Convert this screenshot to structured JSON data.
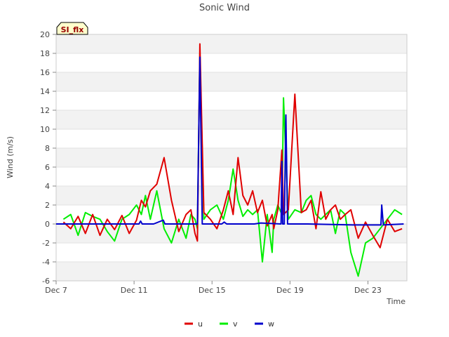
{
  "chart_data": {
    "type": "line",
    "title": "Sonic Wind",
    "xlabel": "Time",
    "ylabel": "Wind (m/s)",
    "badge": "SI_flx",
    "ylim": [
      -6,
      20
    ],
    "yticks": [
      -6,
      -4,
      -2,
      0,
      2,
      4,
      6,
      8,
      10,
      12,
      14,
      16,
      18,
      20
    ],
    "xlim": [
      "2023-12-07",
      "2023-12-25"
    ],
    "xticks": [
      {
        "date": "2023-12-07",
        "label": "Dec 7"
      },
      {
        "date": "2023-12-11",
        "label": "Dec 11"
      },
      {
        "date": "2023-12-15",
        "label": "Dec 15"
      },
      {
        "date": "2023-12-19",
        "label": "Dec 19"
      },
      {
        "date": "2023-12-23",
        "label": "Dec 23"
      }
    ],
    "grid": "horizontal bands",
    "legend": "bottom-center",
    "series": [
      {
        "name": "u",
        "color": "#e00000",
        "x": [
          "2023-12-07T09:00",
          "2023-12-07T18:00",
          "2023-12-08T03:00",
          "2023-12-08T12:00",
          "2023-12-08T21:00",
          "2023-12-09T06:00",
          "2023-12-09T15:00",
          "2023-12-10T00:00",
          "2023-12-10T09:00",
          "2023-12-10T18:00",
          "2023-12-11T03:00",
          "2023-12-11T09:00",
          "2023-12-11T14:00",
          "2023-12-11T20:00",
          "2023-12-12T04:00",
          "2023-12-12T13:00",
          "2023-12-12T22:00",
          "2023-12-13T07:00",
          "2023-12-13T16:00",
          "2023-12-13T22:00",
          "2023-12-14T03:00",
          "2023-12-14T06:00",
          "2023-12-14T09:00",
          "2023-12-14T14:00",
          "2023-12-14T22:00",
          "2023-12-15T06:00",
          "2023-12-15T14:00",
          "2023-12-15T20:00",
          "2023-12-16T02:00",
          "2023-12-16T08:00",
          "2023-12-16T14:00",
          "2023-12-16T20:00",
          "2023-12-17T02:00",
          "2023-12-17T08:00",
          "2023-12-17T14:00",
          "2023-12-17T20:00",
          "2023-12-18T02:00",
          "2023-12-18T04:00",
          "2023-12-18T09:00",
          "2023-12-18T14:00",
          "2023-12-18T16:00",
          "2023-12-18T22:00",
          "2023-12-19T06:00",
          "2023-12-19T14:00",
          "2023-12-19T20:00",
          "2023-12-20T02:00",
          "2023-12-20T08:00",
          "2023-12-20T14:00",
          "2023-12-20T20:00",
          "2023-12-21T02:00",
          "2023-12-21T08:00",
          "2023-12-21T14:00",
          "2023-12-21T20:00",
          "2023-12-22T03:00",
          "2023-12-22T12:00",
          "2023-12-22T21:00",
          "2023-12-23T06:00",
          "2023-12-23T15:00",
          "2023-12-24T00:00",
          "2023-12-24T09:00",
          "2023-12-24T18:00"
        ],
        "values": [
          0.2,
          -0.5,
          0.8,
          -1.0,
          1.0,
          -1.2,
          0.5,
          -0.6,
          0.9,
          -1.0,
          0.4,
          2.5,
          1.8,
          3.5,
          4.2,
          7.0,
          2.5,
          -0.8,
          1.0,
          1.5,
          -1.0,
          -1.8,
          19.0,
          1.2,
          0.5,
          -0.5,
          1.5,
          3.5,
          1.0,
          7.0,
          3.0,
          2.0,
          3.5,
          1.2,
          2.5,
          -0.2,
          1.0,
          -0.5,
          1.5,
          7.8,
          1.0,
          1.5,
          13.7,
          1.2,
          1.5,
          2.5,
          -0.5,
          3.4,
          0.5,
          1.5,
          2.0,
          0.5,
          1.0,
          1.5,
          -1.5,
          0.2,
          -1.2,
          -2.5,
          0.5,
          -0.8,
          -0.5
        ]
      },
      {
        "name": "v",
        "color": "#00ee00",
        "x": [
          "2023-12-07T09:00",
          "2023-12-07T18:00",
          "2023-12-08T03:00",
          "2023-12-08T12:00",
          "2023-12-08T21:00",
          "2023-12-09T06:00",
          "2023-12-09T15:00",
          "2023-12-10T00:00",
          "2023-12-10T09:00",
          "2023-12-10T18:00",
          "2023-12-11T03:00",
          "2023-12-11T09:00",
          "2023-12-11T14:00",
          "2023-12-11T20:00",
          "2023-12-12T04:00",
          "2023-12-12T13:00",
          "2023-12-12T22:00",
          "2023-12-13T07:00",
          "2023-12-13T16:00",
          "2023-12-13T22:00",
          "2023-12-14T03:00",
          "2023-12-14T06:00",
          "2023-12-14T09:00",
          "2023-12-14T14:00",
          "2023-12-14T22:00",
          "2023-12-15T06:00",
          "2023-12-15T14:00",
          "2023-12-15T20:00",
          "2023-12-16T02:00",
          "2023-12-16T08:00",
          "2023-12-16T14:00",
          "2023-12-16T20:00",
          "2023-12-17T02:00",
          "2023-12-17T08:00",
          "2023-12-17T14:00",
          "2023-12-17T20:00",
          "2023-12-18T02:00",
          "2023-12-18T04:00",
          "2023-12-18T09:00",
          "2023-12-18T14:00",
          "2023-12-18T16:00",
          "2023-12-18T22:00",
          "2023-12-19T06:00",
          "2023-12-19T14:00",
          "2023-12-19T20:00",
          "2023-12-20T02:00",
          "2023-12-20T08:00",
          "2023-12-20T14:00",
          "2023-12-20T20:00",
          "2023-12-21T02:00",
          "2023-12-21T08:00",
          "2023-12-21T14:00",
          "2023-12-21T20:00",
          "2023-12-22T03:00",
          "2023-12-22T12:00",
          "2023-12-22T21:00",
          "2023-12-23T06:00",
          "2023-12-23T15:00",
          "2023-12-24T00:00",
          "2023-12-24T09:00",
          "2023-12-24T18:00"
        ],
        "values": [
          0.5,
          1.0,
          -1.2,
          1.2,
          0.8,
          0.5,
          -0.8,
          -1.8,
          0.5,
          1.0,
          2.0,
          1.0,
          3.0,
          0.5,
          3.5,
          -0.5,
          -2.0,
          0.5,
          -1.5,
          1.0,
          0.5,
          -0.5,
          18.0,
          0.5,
          1.5,
          2.0,
          0.5,
          2.5,
          5.8,
          2.5,
          0.8,
          1.5,
          1.0,
          1.5,
          -4.0,
          1.0,
          -3.0,
          0.5,
          2.0,
          1.0,
          13.3,
          0.5,
          1.5,
          1.2,
          2.5,
          3.0,
          1.0,
          0.5,
          1.0,
          1.5,
          -1.0,
          1.5,
          1.0,
          -3.0,
          -5.5,
          -2.0,
          -1.5,
          -0.5,
          0.5,
          1.5,
          1.0
        ]
      },
      {
        "name": "w",
        "color": "#0000cc",
        "x": [
          "2023-12-07T00:00",
          "2023-12-11T06:00",
          "2023-12-11T08:00",
          "2023-12-11T10:00",
          "2023-12-12T00:00",
          "2023-12-12T12:00",
          "2023-12-12T14:00",
          "2023-12-14T06:00",
          "2023-12-14T09:00",
          "2023-12-14T12:00",
          "2023-12-15T12:00",
          "2023-12-15T15:00",
          "2023-12-15T18:00",
          "2023-12-17T04:00",
          "2023-12-17T12:00",
          "2023-12-18T13:00",
          "2023-12-18T14:00",
          "2023-12-18T15:00",
          "2023-12-18T17:00",
          "2023-12-18T19:00",
          "2023-12-18T21:00",
          "2023-12-19T22:00",
          "2023-12-22T06:00",
          "2023-12-23T16:00",
          "2023-12-23T17:00",
          "2023-12-23T19:00",
          "2023-12-24T20:00"
        ],
        "values": [
          0.0,
          0.0,
          0.3,
          0.0,
          0.0,
          0.4,
          0.0,
          0.0,
          17.6,
          0.0,
          0.0,
          0.2,
          0.0,
          0.0,
          0.1,
          0.0,
          6.6,
          0.0,
          0.0,
          11.5,
          0.0,
          0.0,
          -0.1,
          -0.1,
          2.0,
          -0.1,
          0.0
        ]
      }
    ]
  }
}
